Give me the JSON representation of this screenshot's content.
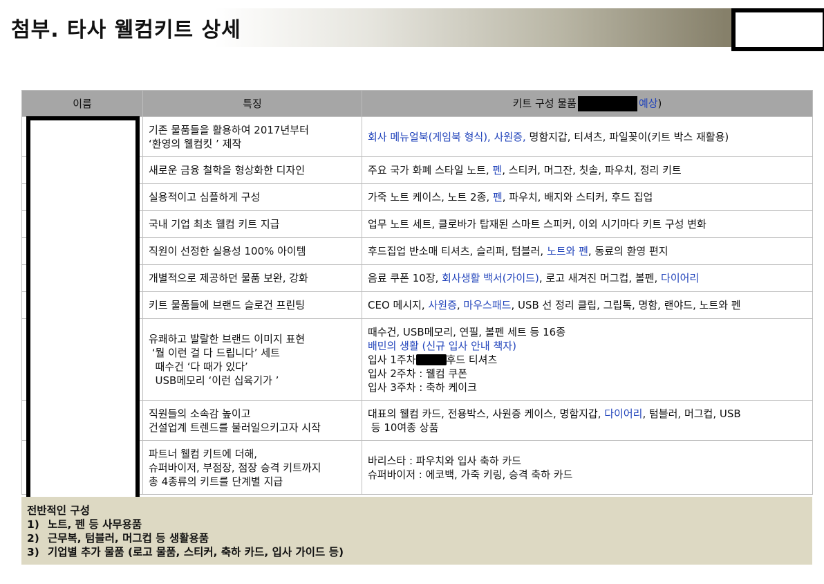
{
  "title": "첨부. 타사 웰컴키트 상세",
  "table": {
    "headers": {
      "name": "이름",
      "features": "특징",
      "items_prefix": "키트 구성 물품",
      "items_suffix_blue": "예상",
      "items_suffix": ")"
    },
    "rows": [
      {
        "feature_lines": [
          "기존 물품들을 활용하여 2017년부터",
          "‘환영의 웰컴킷 ’ 제작"
        ],
        "items": [
          {
            "t": "회사 메뉴얼북(게임북 형식), 사원증,",
            "b": true
          },
          {
            "t": " 명함지갑, 티셔츠, 파일꽂이(키트 박스 재활용)",
            "b": false
          }
        ]
      },
      {
        "feature_lines": [
          "새로운 금융 철학을 형상화한 디자인"
        ],
        "items": [
          {
            "t": "주요 국가 화폐 스타일 노트, ",
            "b": false
          },
          {
            "t": "펜",
            "b": true
          },
          {
            "t": ", 스티커, 머그잔, 칫솔, 파우치, 정리 키트",
            "b": false
          }
        ]
      },
      {
        "feature_lines": [
          "실용적이고 심플하게 구성"
        ],
        "items": [
          {
            "t": "가죽 노트 케이스, 노트 2종, ",
            "b": false
          },
          {
            "t": "펜",
            "b": true
          },
          {
            "t": ", 파우치, 배지와 스티커, 후드 집업",
            "b": false
          }
        ]
      },
      {
        "feature_lines": [
          "국내 기업 최초 웰컴 키트 지급"
        ],
        "items": [
          {
            "t": "업무 노트 세트, 클로바가 탑재된 스마트 스피커, 이외 시기마다 키트 구성 변화",
            "b": false
          }
        ]
      },
      {
        "feature_lines": [
          "직원이 선정한 실용성 100% 아이템"
        ],
        "items": [
          {
            "t": "후드집업 반소매 티셔츠, 슬리퍼, 텀블러, ",
            "b": false
          },
          {
            "t": "노트와 펜",
            "b": true
          },
          {
            "t": ", 동료의 환영 편지",
            "b": false
          }
        ]
      },
      {
        "feature_lines": [
          "개별적으로 제공하던 물품 보완, 강화"
        ],
        "items": [
          {
            "t": "음료 쿠폰 10장, ",
            "b": false
          },
          {
            "t": "회사생활 백서(가이드)",
            "b": true
          },
          {
            "t": ", 로고 새겨진 머그컵, 볼펜, ",
            "b": false
          },
          {
            "t": "다이어리",
            "b": true
          }
        ]
      },
      {
        "feature_lines": [
          "키트 물품들에 브랜드 슬로건 프린팅"
        ],
        "items": [
          {
            "t": "CEO 메시지, ",
            "b": false
          },
          {
            "t": "사원증",
            "b": true
          },
          {
            "t": ", ",
            "b": false
          },
          {
            "t": "마우스패드",
            "b": true
          },
          {
            "t": ", USB 선 정리 클립, 그립톡, 명함, 랜야드, 노트와 펜",
            "b": false
          }
        ]
      },
      {
        "feature_lines": [
          "유쾌하고 발랄한 브랜드 이미지 표현",
          " ‘뭘 이런 걸 다 드립니다’ 세트",
          "  때수건 ‘다 때가 있다’",
          "  USB메모리 ‘이런 십육기가 ’"
        ],
        "item_lines": {
          "l1": "때수건, USB메모리, 연필, 볼펜 세트 등 16종",
          "l2_blue": "배민의 생활 (신규 입사 안내 책자)",
          "l3_prefix": "입사 1주차",
          "l3_suffix": "후드 티셔츠",
          "l4": "입사 2주차 : 웰컴 쿠폰",
          "l5": "입사 3주차 : 축하 케이크"
        }
      },
      {
        "feature_lines": [
          "직원들의 소속감 높이고",
          "건설업계 트렌드를 불러일으키고자 시작"
        ],
        "item_lines": {
          "l1_a": "대표의 웰컴 카드, 전용박스, 사원증 케이스, 명함지갑, ",
          "l1_blue": "다이어리",
          "l1_b": ", 텀블러, 머그컵, USB",
          "l2": " 등 10여종 상품"
        }
      },
      {
        "feature_lines": [
          "파트너 웰컴 키트에 더해,",
          "슈퍼바이저, 부점장, 점장 승격 키트까지",
          "총 4종류의 키트를 단계별 지급"
        ],
        "item_lines": {
          "l1": "바리스타 : 파우치와 입사 축하 카드",
          "l2": "슈퍼바이저 : 에코백, 가죽 키링, 승격 축하 카드"
        }
      }
    ]
  },
  "summary": {
    "heading": "전반적인 구성",
    "items": [
      {
        "num": "1)",
        "text": "노트, 펜 등 사무용품"
      },
      {
        "num": "2)",
        "text": "근무복, 텀블러, 머그컵 등 생활용품"
      },
      {
        "num": "3)",
        "text": "기업별 추가 물품 (로고 물품, 스티커, 축하 카드, 입사 가이드 등)"
      }
    ]
  },
  "colors": {
    "header_bg": "#a6a6a6",
    "summary_bg": "#ddd9c3",
    "link_blue": "#2244bb",
    "redaction": "#000000"
  }
}
